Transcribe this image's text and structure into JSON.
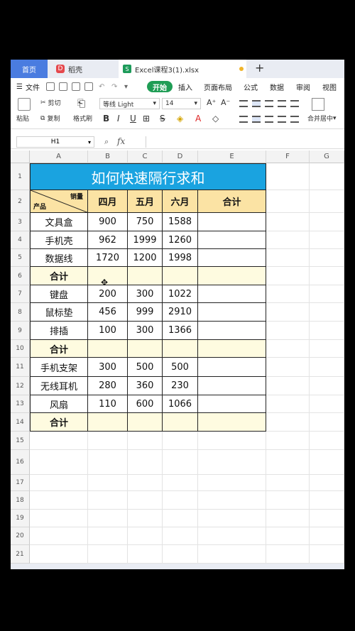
{
  "tabs": {
    "home": "首页",
    "shell": "稻壳",
    "file": "Excel课程3(1).xlsx",
    "plus": "+"
  },
  "menu": {
    "file": "文件",
    "start": "开始",
    "insert": "插入",
    "layout": "页面布局",
    "formula": "公式",
    "data": "数据",
    "review": "审阅",
    "view": "视图"
  },
  "ribbon": {
    "paste": "粘贴",
    "cut": "剪切",
    "copy": "复制",
    "format_painter": "格式刷",
    "font": "等线 Light",
    "size": "14",
    "merge": "合并居中",
    "bold": "B",
    "italic": "I",
    "underline": "U"
  },
  "formula_bar": {
    "name_box": "H1",
    "fx": "fx",
    "value": ""
  },
  "columns": [
    "A",
    "B",
    "C",
    "D",
    "E",
    "F",
    "G"
  ],
  "rows": [
    "1",
    "2",
    "3",
    "4",
    "5",
    "6",
    "7",
    "8",
    "9",
    "10",
    "11",
    "12",
    "13",
    "14",
    "15",
    "16",
    "17",
    "18",
    "19",
    "20",
    "21"
  ],
  "sheet": {
    "title": "如何快速隔行求和",
    "diag_top": "销量",
    "diag_bottom": "产品",
    "headers": [
      "四月",
      "五月",
      "六月",
      "合计"
    ],
    "body": [
      [
        "文具盒",
        "900",
        "750",
        "1588",
        ""
      ],
      [
        "手机壳",
        "962",
        "1999",
        "1260",
        ""
      ],
      [
        "数据线",
        "1720",
        "1200",
        "1998",
        ""
      ],
      [
        "合计",
        "",
        "",
        "",
        ""
      ],
      [
        "键盘",
        "200",
        "300",
        "1022",
        ""
      ],
      [
        "鼠标垫",
        "456",
        "999",
        "2910",
        ""
      ],
      [
        "排插",
        "100",
        "300",
        "1366",
        ""
      ],
      [
        "合计",
        "",
        "",
        "",
        ""
      ],
      [
        "手机支架",
        "300",
        "500",
        "500",
        ""
      ],
      [
        "无线耳机",
        "280",
        "360",
        "230",
        ""
      ],
      [
        "风扇",
        "110",
        "600",
        "1066",
        ""
      ],
      [
        "合计",
        "",
        "",
        "",
        ""
      ]
    ]
  }
}
